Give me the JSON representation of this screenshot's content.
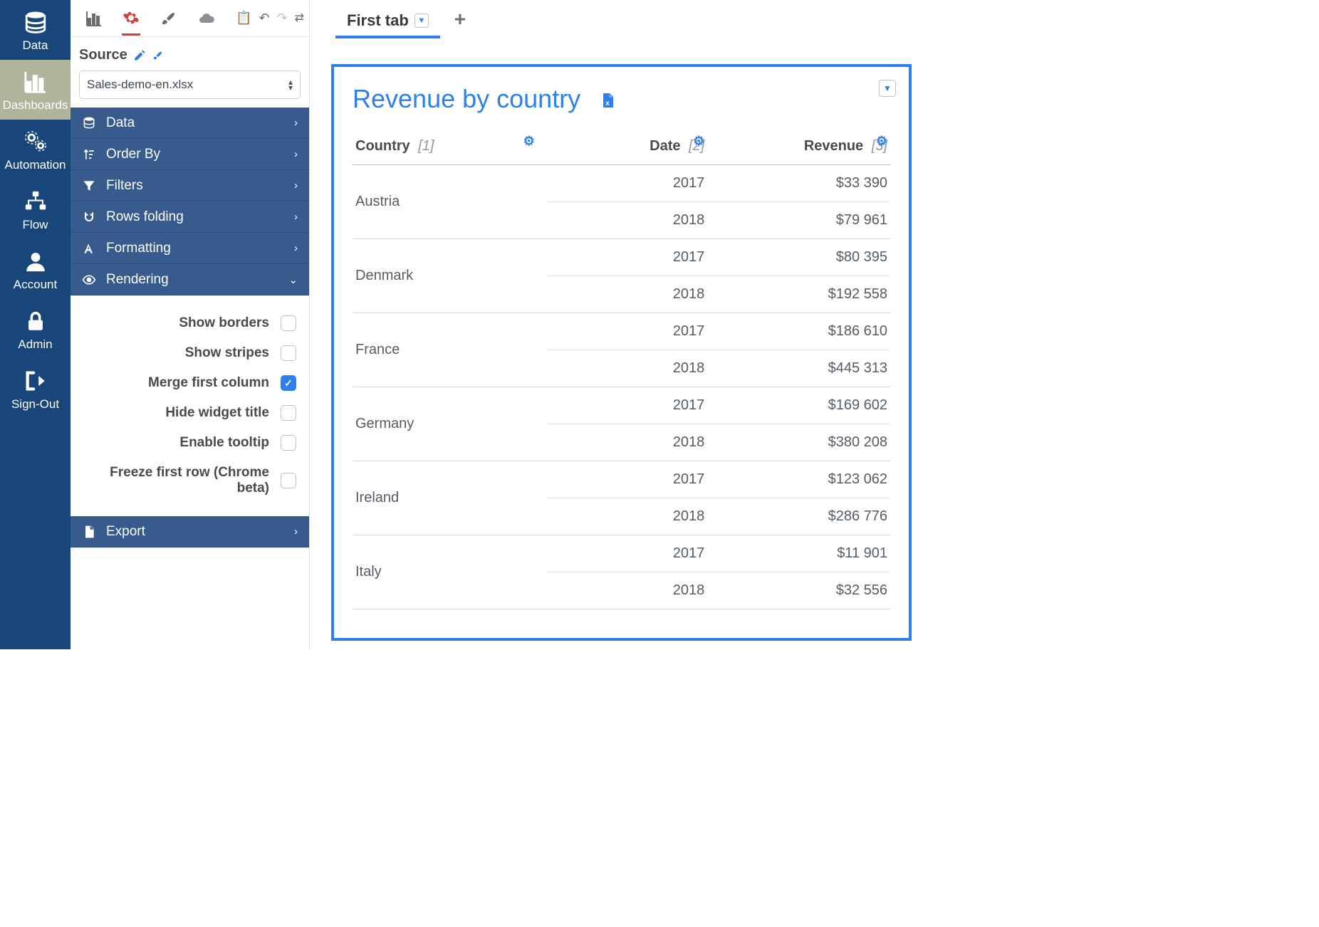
{
  "nav": [
    {
      "id": "data",
      "label": "Data",
      "icon": "database"
    },
    {
      "id": "dashboards",
      "label": "Dashboards",
      "icon": "barchart",
      "active": true
    },
    {
      "id": "automation",
      "label": "Automation",
      "icon": "gears"
    },
    {
      "id": "flow",
      "label": "Flow",
      "icon": "flow"
    },
    {
      "id": "account",
      "label": "Account",
      "icon": "user"
    },
    {
      "id": "admin",
      "label": "Admin",
      "icon": "lock"
    },
    {
      "id": "signout",
      "label": "Sign-Out",
      "icon": "signout"
    }
  ],
  "source": {
    "label": "Source",
    "selected": "Sales-demo-en.xlsx"
  },
  "sections": [
    {
      "id": "data",
      "label": "Data",
      "icon": "database",
      "chev": "right"
    },
    {
      "id": "orderby",
      "label": "Order By",
      "icon": "sort",
      "chev": "right"
    },
    {
      "id": "filters",
      "label": "Filters",
      "icon": "funnel",
      "chev": "right"
    },
    {
      "id": "rowsfolding",
      "label": "Rows folding",
      "icon": "magnet",
      "chev": "right"
    },
    {
      "id": "formatting",
      "label": "Formatting",
      "icon": "font",
      "chev": "right"
    },
    {
      "id": "rendering",
      "label": "Rendering",
      "icon": "eye",
      "chev": "down",
      "expanded": true
    },
    {
      "id": "export",
      "label": "Export",
      "icon": "file",
      "chev": "right"
    }
  ],
  "rendering_options": [
    {
      "label": "Show borders",
      "checked": false
    },
    {
      "label": "Show stripes",
      "checked": false
    },
    {
      "label": "Merge first column",
      "checked": true
    },
    {
      "label": "Hide widget title",
      "checked": false
    },
    {
      "label": "Enable tooltip",
      "checked": false
    },
    {
      "label": "Freeze first row (Chrome beta)",
      "checked": false
    }
  ],
  "tabs": {
    "active": "First tab"
  },
  "widget": {
    "title": "Revenue by country",
    "columns": [
      {
        "label": "Country",
        "idx": "[1]",
        "align": "left"
      },
      {
        "label": "Date",
        "idx": "[2]",
        "align": "right"
      },
      {
        "label": "Revenue",
        "idx": "[3]",
        "align": "right"
      }
    ]
  },
  "chart_data": {
    "type": "table",
    "columns": [
      "Country",
      "Date",
      "Revenue"
    ],
    "rows": [
      {
        "country": "Austria",
        "date": "2017",
        "revenue": "$33 390"
      },
      {
        "country": "Austria",
        "date": "2018",
        "revenue": "$79 961"
      },
      {
        "country": "Denmark",
        "date": "2017",
        "revenue": "$80 395"
      },
      {
        "country": "Denmark",
        "date": "2018",
        "revenue": "$192 558"
      },
      {
        "country": "France",
        "date": "2017",
        "revenue": "$186 610"
      },
      {
        "country": "France",
        "date": "2018",
        "revenue": "$445 313"
      },
      {
        "country": "Germany",
        "date": "2017",
        "revenue": "$169 602"
      },
      {
        "country": "Germany",
        "date": "2018",
        "revenue": "$380 208"
      },
      {
        "country": "Ireland",
        "date": "2017",
        "revenue": "$123 062"
      },
      {
        "country": "Ireland",
        "date": "2018",
        "revenue": "$286 776"
      },
      {
        "country": "Italy",
        "date": "2017",
        "revenue": "$11 901"
      },
      {
        "country": "Italy",
        "date": "2018",
        "revenue": "$32 556"
      }
    ]
  }
}
